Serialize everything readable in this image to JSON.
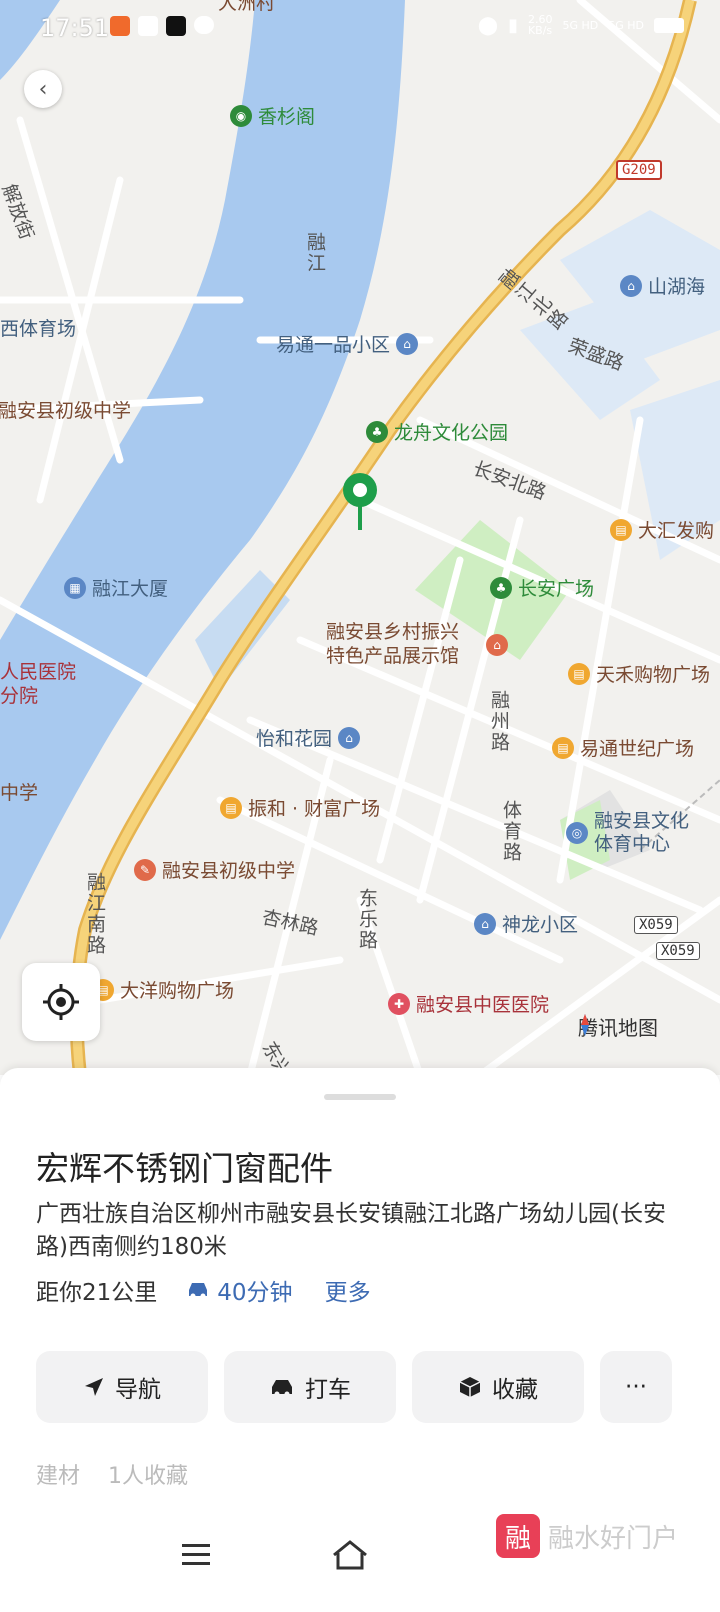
{
  "status": {
    "time": "17:51",
    "network_speed": "2.60",
    "network_unit": "KB/s",
    "sig1": "5G HD",
    "sig2": "5G HD"
  },
  "map": {
    "labels": {
      "xiangshange": "香杉阁",
      "dazhoucun": "大洲村",
      "rongjiang_river": "融江",
      "jiefangjie": "解放街",
      "tiyuchang": "西体育场",
      "chuji1": "融安县初级中学",
      "yitong": "易通一品小区",
      "longzhou": "龙舟文化公园",
      "changanbeilu": "长安北路",
      "rongjiangbeilu": "融江北路",
      "shanhuhai": "山湖海",
      "rongshenglu": "荣盛路",
      "dahui": "大汇发购",
      "changan_guangchang": "长安广场",
      "rongjiangdasha": "融江大厦",
      "xiangcun1": "融安县乡村振兴",
      "xiangcun2": "特色产品展示馆",
      "tianhe": "天禾购物广场",
      "renmin1": "人民医院",
      "renmin2": "分院",
      "yihe": "怡和花园",
      "rongzhoulu": "融州路",
      "yitongshiji": "易通世纪广场",
      "zhongxue": "中学",
      "zhenhe": "振和 · 财富广场",
      "tiyulu": "体育路",
      "wenhua1": "融安县文化",
      "wenhua2": "体育中心",
      "chuji2": "融安县初级中学",
      "rongjiangnanlu": "融江南路",
      "donglelu": "东乐路",
      "xinglinlu": "杏林路",
      "shenlong": "神龙小区",
      "dayang": "大洋购物广场",
      "zhongyi": "融安县中医医院",
      "dongxinglu": "东兴路",
      "g209": "G209",
      "x059a": "X059",
      "x059b": "X059",
      "tencent_logo": "腾讯地图"
    }
  },
  "place": {
    "name": "宏辉不锈钢门窗配件",
    "address": "广西壮族自治区柳州市融安县长安镇融江北路广场幼儿园(长安路)西南侧约180米",
    "distance": "距你21公里",
    "drive_time": "40分钟",
    "more": "更多",
    "tags": [
      "建材",
      "1人收藏"
    ]
  },
  "actions": {
    "navigate": "导航",
    "taxi": "打车",
    "favorite": "收藏",
    "more": "···"
  },
  "watermark": {
    "icon_char": "融",
    "text": "融水好门户"
  },
  "colors": {
    "water": "#a8c9ef",
    "road_main": "#f3c766",
    "park": "#cfeec2",
    "pin": "#1e9e4a",
    "link": "#3d6bb3"
  }
}
